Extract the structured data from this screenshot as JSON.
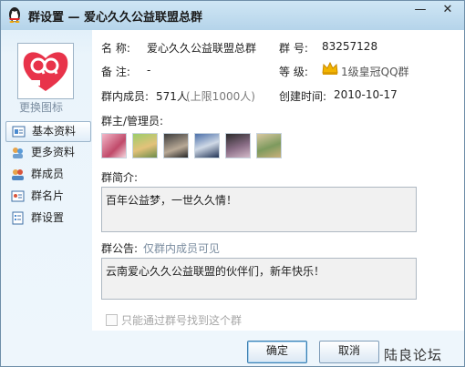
{
  "window": {
    "title": "群设置 — 爱心久久公益联盟总群",
    "minimize_glyph": "—",
    "close_glyph": "✕"
  },
  "sidebar": {
    "change_icon_label": "更换图标",
    "items": [
      {
        "label": "基本资料",
        "icon": "profile-card-icon",
        "active": true
      },
      {
        "label": "更多资料",
        "icon": "more-info-icon",
        "active": false
      },
      {
        "label": "群成员",
        "icon": "members-icon",
        "active": false
      },
      {
        "label": "群名片",
        "icon": "business-card-icon",
        "active": false
      },
      {
        "label": "群设置",
        "icon": "settings-icon",
        "active": false
      }
    ]
  },
  "info": {
    "name_label": "名  称:",
    "name_value": "爱心久久公益联盟总群",
    "number_label": "群  号:",
    "number_value": "83257128",
    "remark_label": "备  注:",
    "remark_value": "-",
    "level_label": "等  级:",
    "level_value": "1级皇冠QQ群",
    "members_label": "群内成员:",
    "members_count": "571人",
    "members_limit": "(上限1000人)",
    "created_label": "创建时间:",
    "created_value": "2010-10-17"
  },
  "admins": {
    "label": "群主/管理员:",
    "avatars": [
      "admin-avatar-1",
      "admin-avatar-2",
      "admin-avatar-3",
      "admin-avatar-4",
      "admin-avatar-5",
      "admin-avatar-6"
    ]
  },
  "intro": {
    "label": "群简介:",
    "text": "百年公益梦，一世久久情！"
  },
  "announcement": {
    "label": "群公告:",
    "note": "仅群内成员可见",
    "text": "云南爱心久久公益联盟的伙伴们，新年快乐！"
  },
  "options": {
    "search_only_label": "只能通过群号找到这个群",
    "search_only_checked": false
  },
  "buttons": {
    "ok": "确定",
    "cancel": "取消"
  },
  "watermark": "陆良论坛",
  "colors": {
    "accent": "#3c7fb1",
    "logo_red": "#e8334a",
    "crown": "#f2b400"
  }
}
